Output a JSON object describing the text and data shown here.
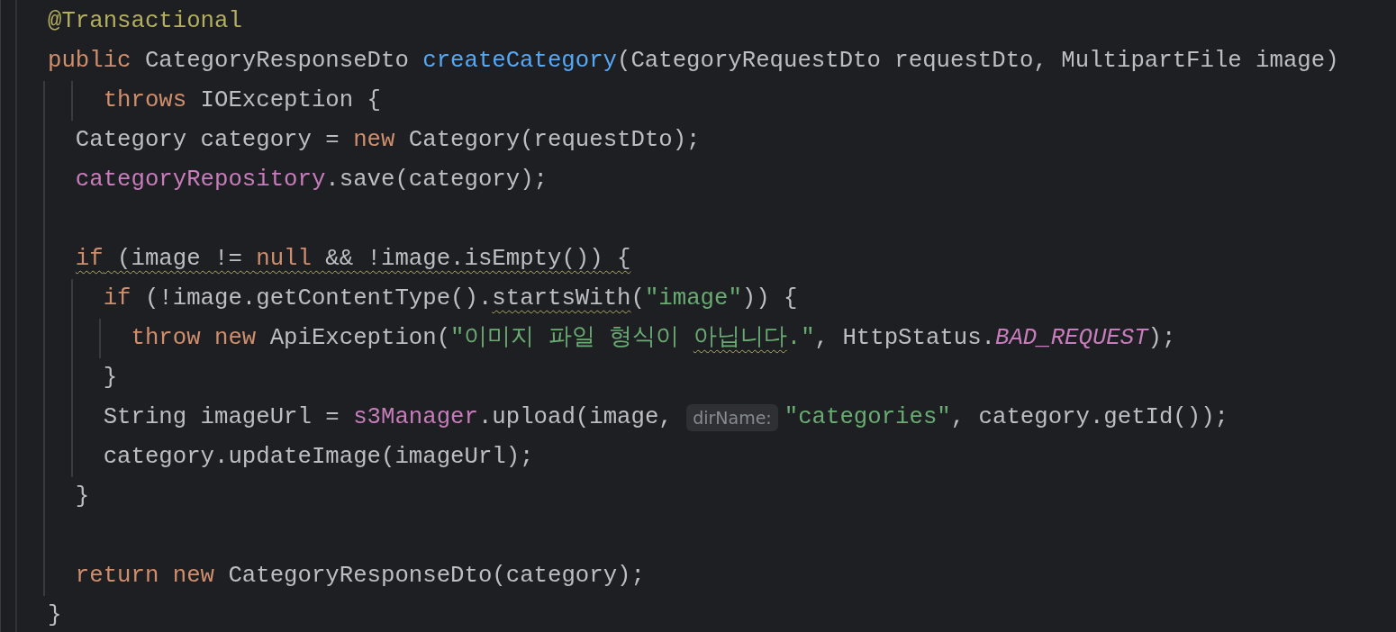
{
  "editor": {
    "lines": [
      {
        "tokens": [
          {
            "kind": "annotation",
            "text": "@Transactional"
          }
        ]
      },
      {
        "tokens": [
          {
            "kind": "keyword",
            "text": "public"
          },
          {
            "kind": "plain",
            "text": " CategoryResponseDto "
          },
          {
            "kind": "method",
            "text": "createCategory"
          },
          {
            "kind": "plain",
            "text": "(CategoryRequestDto requestDto, MultipartFile image)"
          }
        ]
      },
      {
        "tokens": [
          {
            "kind": "keyword",
            "text": "    throws"
          },
          {
            "kind": "plain",
            "text": " IOException {"
          }
        ]
      },
      {
        "tokens": [
          {
            "kind": "plain",
            "text": "  Category category = "
          },
          {
            "kind": "keyword",
            "text": "new"
          },
          {
            "kind": "plain",
            "text": " Category(requestDto);"
          }
        ]
      },
      {
        "tokens": [
          {
            "kind": "field",
            "text": "  categoryRepository"
          },
          {
            "kind": "plain",
            "text": ".save(category);"
          }
        ]
      },
      {
        "kind": "blank"
      },
      {
        "tokens": [
          {
            "kind": "keyword",
            "text": "  if",
            "warning": true
          },
          {
            "kind": "plain",
            "text": " (image != ",
            "warning": true
          },
          {
            "kind": "keyword",
            "text": "null",
            "warning": true
          },
          {
            "kind": "plain",
            "text": " && !image.isEmpty()) {",
            "warning": true
          }
        ]
      },
      {
        "tokens": [
          {
            "kind": "keyword",
            "text": "    if"
          },
          {
            "kind": "plain",
            "text": " (!image.getContentType()."
          },
          {
            "kind": "plain",
            "text": "startsWith",
            "warning": true
          },
          {
            "kind": "plain",
            "text": "("
          },
          {
            "kind": "string",
            "text": "\"image\""
          },
          {
            "kind": "plain",
            "text": ")) {"
          }
        ]
      },
      {
        "tokens": [
          {
            "kind": "keyword",
            "text": "      throw"
          },
          {
            "kind": "keyword",
            "text": " new"
          },
          {
            "kind": "plain",
            "text": " ApiException("
          },
          {
            "kind": "string",
            "text": "\"이미지 파일 형식이 "
          },
          {
            "kind": "string",
            "text": "아닙니다",
            "warning": true
          },
          {
            "kind": "string",
            "text": ".\""
          },
          {
            "kind": "plain",
            "text": ", HttpStatus."
          },
          {
            "kind": "constant",
            "text": "BAD_REQUEST"
          },
          {
            "kind": "plain",
            "text": ");"
          }
        ]
      },
      {
        "tokens": [
          {
            "kind": "plain",
            "text": "    }"
          }
        ]
      },
      {
        "tokens": [
          {
            "kind": "plain",
            "text": "    String imageUrl = "
          },
          {
            "kind": "field",
            "text": "s3Manager"
          },
          {
            "kind": "plain",
            "text": ".upload(image, "
          },
          {
            "kind": "hint",
            "text": "dirName:"
          },
          {
            "kind": "string",
            "text": "\"categories\""
          },
          {
            "kind": "plain",
            "text": ", category.getId());"
          }
        ]
      },
      {
        "tokens": [
          {
            "kind": "plain",
            "text": "    category.updateImage(imageUrl);"
          }
        ]
      },
      {
        "tokens": [
          {
            "kind": "plain",
            "text": "  }"
          }
        ]
      },
      {
        "kind": "blank"
      },
      {
        "tokens": [
          {
            "kind": "keyword",
            "text": "  return"
          },
          {
            "kind": "keyword",
            "text": " new"
          },
          {
            "kind": "plain",
            "text": " CategoryResponseDto(category);"
          }
        ]
      },
      {
        "tokens": [
          {
            "kind": "plain",
            "text": "}"
          }
        ]
      }
    ]
  }
}
